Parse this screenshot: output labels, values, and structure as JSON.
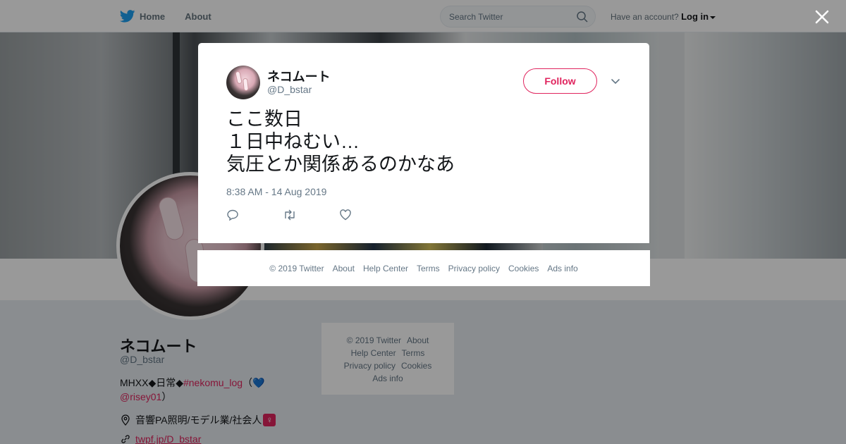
{
  "nav": {
    "home_label": "Home",
    "about_label": "About",
    "search_placeholder": "Search Twitter",
    "account_prompt": "Have an account?",
    "login_label": "Log in"
  },
  "profile": {
    "name": "ネコムート",
    "handle": "@D_bstar",
    "bio_prefix": "MHXX◆日常◆",
    "bio_hashtag": "#nekomu_log",
    "bio_middle": "（",
    "bio_heart": "💙",
    "bio_mention": "@risey01",
    "bio_suffix": "）",
    "location": "音響PA照明/モデル業/社会人",
    "location_badge": "♀",
    "url": "twpf.jp/D_bstar"
  },
  "side_footer": {
    "copyright": "© 2019 Twitter",
    "about": "About",
    "help": "Help Center",
    "terms": "Terms",
    "privacy": "Privacy policy",
    "cookies": "Cookies",
    "ads": "Ads info"
  },
  "tweet": {
    "author_name": "ネコムート",
    "author_handle": "@D_bstar",
    "follow_label": "Follow",
    "text": "ここ数日\n１日中ねむい…\n気圧とか関係あるのかなあ",
    "timestamp": "8:38 AM - 14 Aug 2019"
  },
  "modal_footer": {
    "copyright": "© 2019 Twitter",
    "about": "About",
    "help": "Help Center",
    "terms": "Terms",
    "privacy": "Privacy policy",
    "cookies": "Cookies",
    "ads": "Ads info"
  },
  "colors": {
    "accent": "#e0245e",
    "twitter_blue": "#1da1f2",
    "secondary_text": "#657786"
  },
  "icons": [
    "twitter-bird-icon",
    "search-icon",
    "close-icon",
    "chevron-down-icon",
    "reply-icon",
    "retweet-icon",
    "like-icon",
    "location-icon",
    "link-icon"
  ]
}
